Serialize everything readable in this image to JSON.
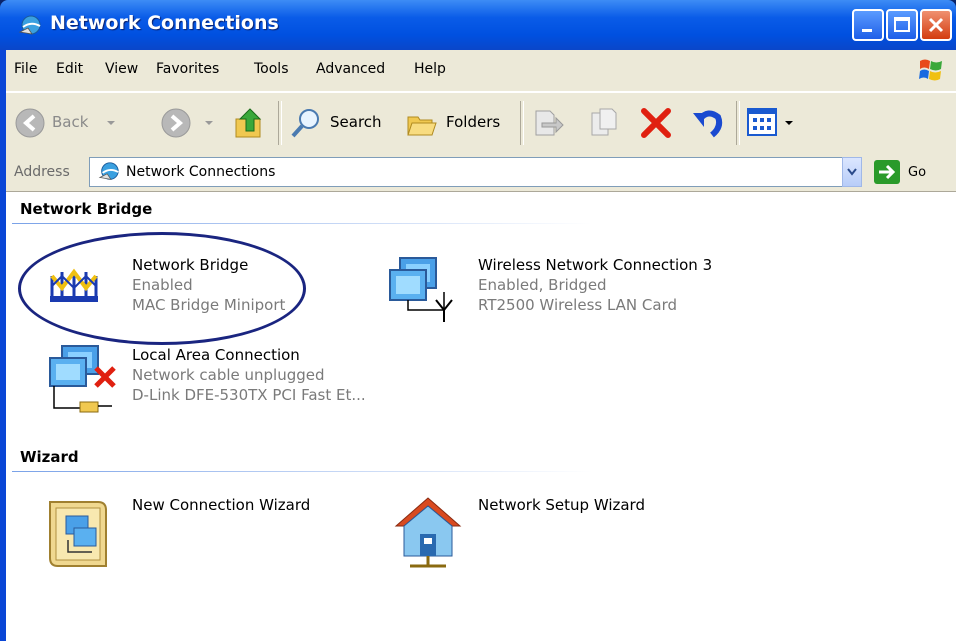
{
  "window": {
    "title": "Network Connections",
    "controls": [
      "minimize",
      "maximize",
      "close"
    ]
  },
  "menubar": {
    "items": [
      "File",
      "Edit",
      "View",
      "Favorites",
      "Tools",
      "Advanced",
      "Help"
    ]
  },
  "toolbar": {
    "back_label": "Back",
    "search_label": "Search",
    "folders_label": "Folders"
  },
  "address": {
    "label": "Address",
    "value": "Network Connections",
    "go_label": "Go"
  },
  "groups": [
    {
      "header": "Network Bridge",
      "items": [
        {
          "name": "Network Bridge",
          "status": "Enabled",
          "device": "MAC Bridge Miniport"
        },
        {
          "name": "Wireless Network Connection 3",
          "status": "Enabled, Bridged",
          "device": "RT2500 Wireless LAN Card"
        },
        {
          "name": "Local Area Connection",
          "status": "Network cable unplugged",
          "device": "D-Link DFE-530TX PCI Fast Et..."
        }
      ]
    },
    {
      "header": "Wizard",
      "items": [
        {
          "name": "New Connection Wizard"
        },
        {
          "name": "Network Setup Wizard"
        }
      ]
    }
  ],
  "colors": {
    "titlebar": "#0a5ce8",
    "chrome": "#ece9d8",
    "highlight_ellipse": "#1a2580",
    "delete_red": "#e02010"
  }
}
